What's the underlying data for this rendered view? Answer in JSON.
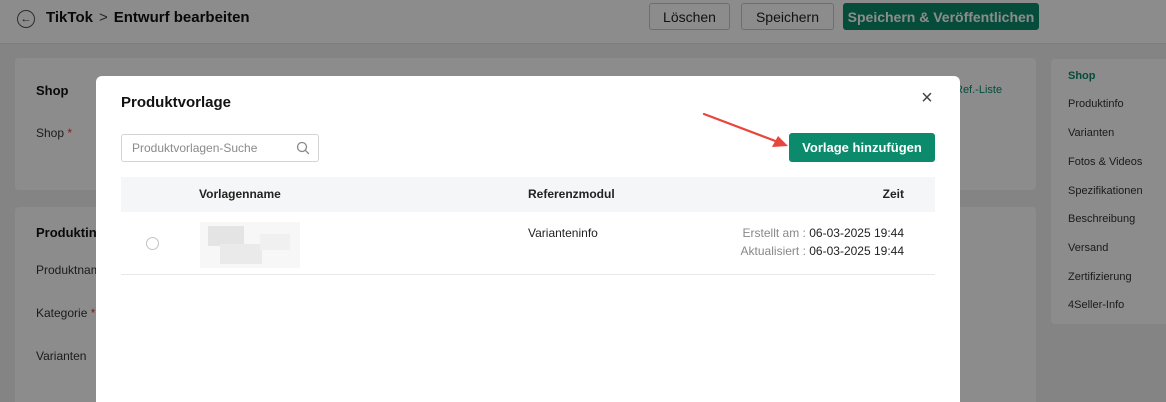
{
  "header": {
    "breadcrumb_root": "TikTok",
    "breadcrumb_sep": ">",
    "breadcrumb_current": "Entwurf bearbeiten",
    "delete_label": "Löschen",
    "save_label": "Speichern",
    "publish_label": "Speichern & Veröffentlichen"
  },
  "shop_card": {
    "title": "Shop",
    "shop_label": "Shop",
    "required_mark": "*",
    "ref_link": "Ref.-Liste"
  },
  "product_card": {
    "title": "Produktinfo",
    "name_label": "Produktname",
    "category_label": "Kategorie",
    "variants_label": "Varianten"
  },
  "right_nav": {
    "items": [
      "Shop",
      "Produktinfo",
      "Varianten",
      "Fotos & Videos",
      "Spezifikationen",
      "Beschreibung",
      "Versand",
      "Zertifizierung",
      "4Seller-Info"
    ]
  },
  "modal": {
    "title": "Produktvorlage",
    "search_placeholder": "Produktvorlagen-Suche",
    "add_button": "Vorlage hinzufügen",
    "columns": {
      "name": "Vorlagenname",
      "module": "Referenzmodul",
      "time": "Zeit"
    },
    "rows": [
      {
        "module": "Varianteninfo",
        "created_label": "Erstellt am :",
        "created": "06-03-2025 19:44",
        "updated_label": "Aktualisiert :",
        "updated": "06-03-2025 19:44"
      }
    ]
  },
  "colors": {
    "primary": "#0b8a6c",
    "annotation_arrow": "#e8453c"
  },
  "icons": {
    "back": "arrow-left-circle-icon",
    "close": "close-icon",
    "search": "search-icon"
  }
}
